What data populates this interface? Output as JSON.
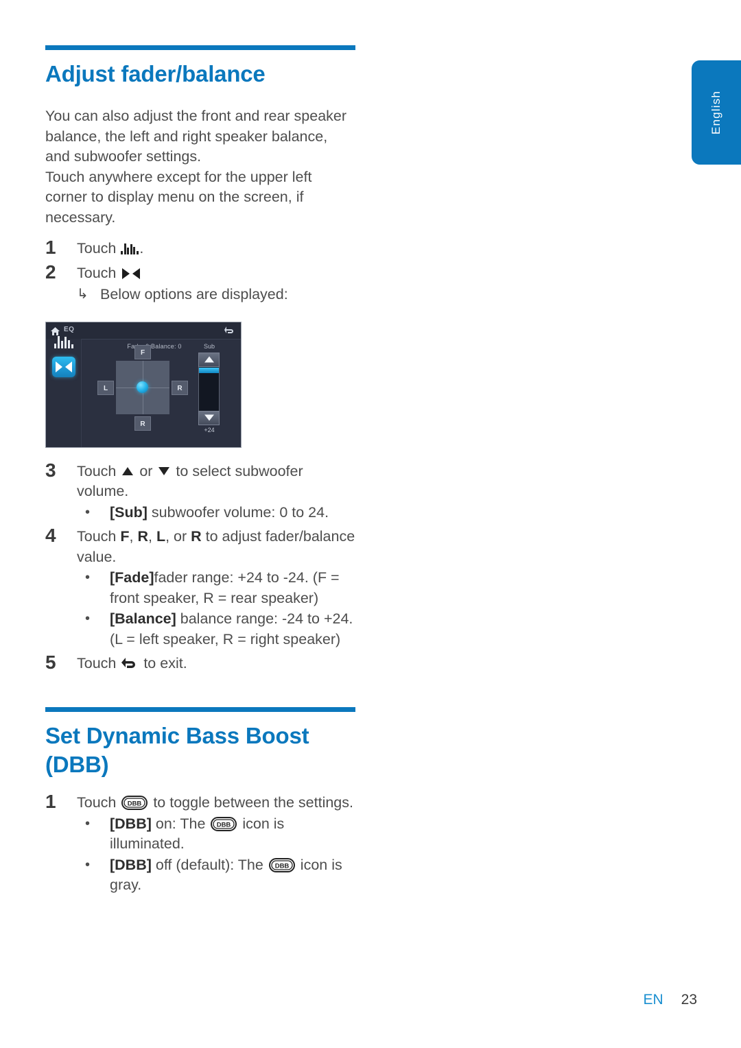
{
  "language_tab": {
    "label": "English"
  },
  "sections": [
    {
      "heading": "Adjust fader/balance",
      "intro": [
        "You can also adjust the front and rear speaker balance, the left and right speaker balance, and subwoofer settings.",
        " Touch anywhere except for the upper left corner to display menu on the screen, if necessary."
      ],
      "steps": [
        {
          "num": "1",
          "prefix": "Touch ",
          "icon": "eq-bars-icon",
          "suffix": "."
        },
        {
          "num": "2",
          "prefix": "Touch ",
          "icon": "fader-balance-icon",
          "suffix": "",
          "subnote": {
            "arrow": "↳",
            "text": "Below options are displayed:"
          }
        },
        {
          "num": "3",
          "prefix": "Touch ",
          "icon": "triangle-up-icon",
          "mid": " or ",
          "icon2": "triangle-down-icon",
          "suffix": " to select subwoofer volume.",
          "bullets": [
            {
              "bold": "[Sub]",
              "text": " subwoofer volume: 0 to 24."
            }
          ]
        },
        {
          "num": "4",
          "prefix": "Touch ",
          "suffix": " to adjust fader/balance value.",
          "keys": [
            "F",
            "R",
            "L",
            "R"
          ],
          "bullets": [
            {
              "bold": "[Fade]",
              "text": "fader range: +24 to -24. (F = front speaker, R = rear speaker)"
            },
            {
              "bold": "[Balance]",
              "text": " balance range: -24 to +24. (L = left speaker, R = right speaker)"
            }
          ]
        },
        {
          "num": "5",
          "prefix": "Touch ",
          "icon": "back-arrow-icon",
          "suffix": " to exit."
        }
      ]
    },
    {
      "heading": "Set Dynamic Bass Boost (DBB)",
      "steps": [
        {
          "num": "1",
          "prefix": "Touch ",
          "icon": "dbb-icon",
          "suffix": " to toggle between the settings.",
          "bullets": [
            {
              "bold": "[DBB]",
              "text_a": " on: The ",
              "icon": "dbb-icon",
              "text_b": " icon is illuminated."
            },
            {
              "bold": "[DBB]",
              "text_a": " off (default): The ",
              "icon": "dbb-icon",
              "text_b": " icon is gray."
            }
          ]
        }
      ]
    }
  ],
  "device_screenshot": {
    "topbar": {
      "home_icon": "home-icon",
      "menu_label": "EQ",
      "back_icon": "back-arrow-icon"
    },
    "left_rail": {
      "eq_icon": "eq-bars-icon",
      "fader_icon": "fader-balance-icon"
    },
    "title": "Fade: 0 Balance: 0",
    "sub_label": "Sub",
    "sub_value": "+24",
    "direction_buttons": {
      "front": "F",
      "left": "L",
      "right": "R",
      "rear": "R"
    }
  },
  "footer": {
    "language_code": "EN",
    "page_number": "23"
  },
  "colors": {
    "accent": "#0b78bd",
    "body_text": "#4d4d4d",
    "device_bg": "#2b3040",
    "device_accent": "#23b3ea"
  }
}
